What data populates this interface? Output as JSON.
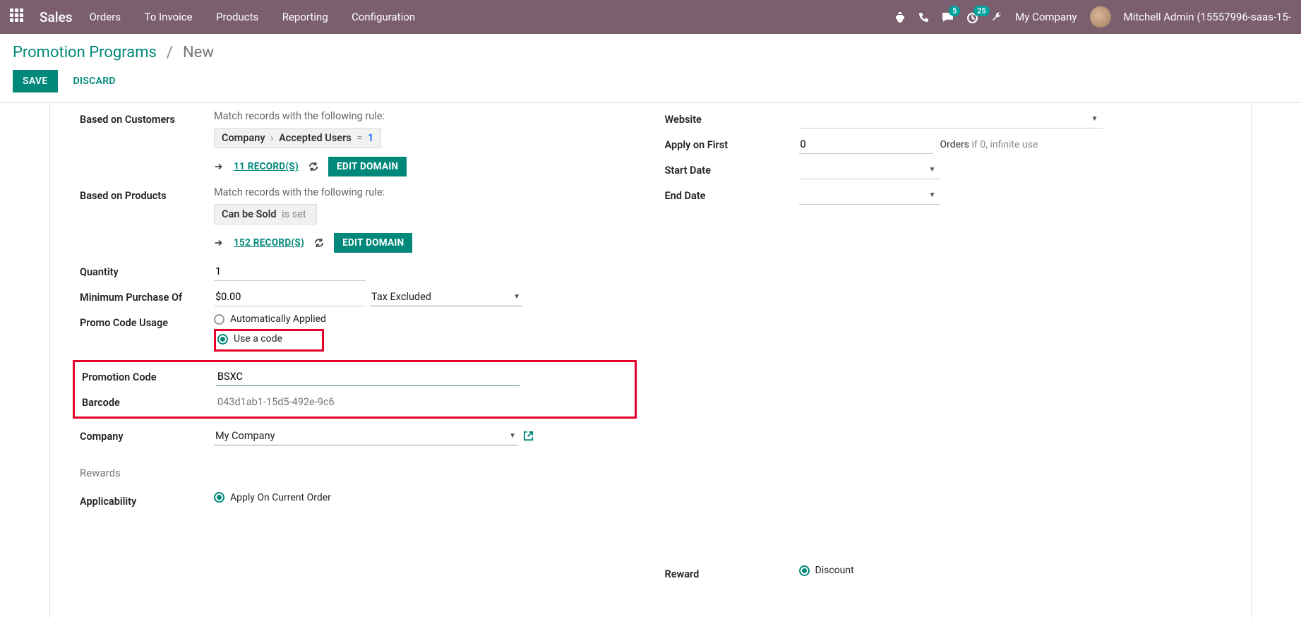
{
  "topbar": {
    "brand": "Sales",
    "nav": [
      "Orders",
      "To Invoice",
      "Products",
      "Reporting",
      "Configuration"
    ],
    "badges": {
      "chat": "5",
      "timer": "25"
    },
    "company": "My Company",
    "user": "Mitchell Admin (15557996-saas-15-"
  },
  "breadcrumb": {
    "parent": "Promotion Programs",
    "current": "New"
  },
  "actions": {
    "save": "SAVE",
    "discard": "DISCARD"
  },
  "left": {
    "based_on_customers": {
      "label": "Based on Customers",
      "desc": "Match records with the following rule:",
      "chip_a": "Company",
      "chip_b": "Accepted Users",
      "chip_op": "=",
      "chip_val": "1",
      "records": "11 RECORD(S)",
      "edit": "EDIT DOMAIN"
    },
    "based_on_products": {
      "label": "Based on Products",
      "desc": "Match records with the following rule:",
      "chip_a": "Can be Sold",
      "chip_b": "is set",
      "records": "152 RECORD(S)",
      "edit": "EDIT DOMAIN"
    },
    "quantity": {
      "label": "Quantity",
      "value": "1"
    },
    "min_purchase": {
      "label": "Minimum Purchase Of",
      "value": "$0.00",
      "tax": "Tax Excluded"
    },
    "promo_usage": {
      "label": "Promo Code Usage",
      "auto": "Automatically Applied",
      "code": "Use a code"
    },
    "promo_code": {
      "label": "Promotion Code",
      "value": "BSXC"
    },
    "barcode": {
      "label": "Barcode",
      "placeholder": "043d1ab1-15d5-492e-9c6"
    },
    "company_field": {
      "label": "Company",
      "value": "My Company"
    }
  },
  "right": {
    "website": {
      "label": "Website"
    },
    "apply_first": {
      "label": "Apply on First",
      "value": "0",
      "suffix_dark": "Orders",
      "suffix": "if 0, infinite use"
    },
    "start_date": {
      "label": "Start Date"
    },
    "end_date": {
      "label": "End Date"
    }
  },
  "rewards": {
    "title": "Rewards",
    "applicability": {
      "label": "Applicability",
      "value": "Apply On Current Order"
    },
    "reward": {
      "label": "Reward",
      "value": "Discount"
    }
  }
}
